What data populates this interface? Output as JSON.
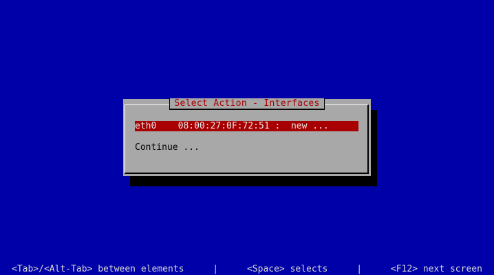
{
  "dialog": {
    "title": "Select Action - Interfaces",
    "interfaces": [
      {
        "label": "eth0    08:00:27:0F:72:51 :  new ..."
      }
    ],
    "continue_label": "Continue ..."
  },
  "status_bar": {
    "hint_tab": "<Tab>/<Alt-Tab> between elements",
    "separator": "|",
    "hint_space": "<Space> selects",
    "hint_f12": "<F12> next screen"
  },
  "colors": {
    "background": "#0000a8",
    "dialog": "#a8a8a8",
    "highlight": "#a80000",
    "title_text": "#a80000"
  }
}
